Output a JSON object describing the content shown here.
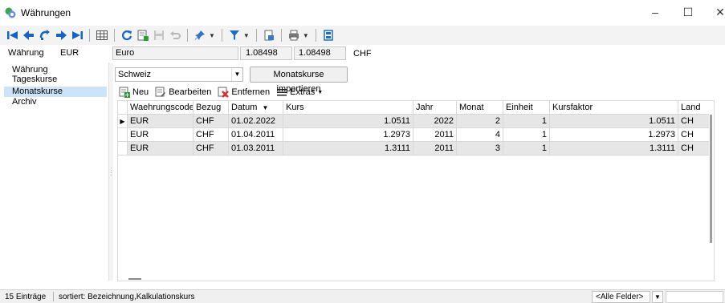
{
  "window": {
    "title": "Währungen",
    "minimize": "–",
    "maximize": "☐",
    "close": "✕"
  },
  "header": {
    "currency_label": "Währung",
    "currency_code": "EUR",
    "currency_name": "Euro",
    "rate1": "1.08498",
    "rate2": "1.08498",
    "base_currency": "CHF"
  },
  "nav": {
    "items": [
      {
        "label": "Währung"
      },
      {
        "label": "Tageskurse"
      },
      {
        "label": "Monatskurse"
      },
      {
        "label": "Archiv"
      }
    ],
    "selected_index": 2
  },
  "controls": {
    "country": "Schweiz",
    "import_button": "Monatskurse importieren"
  },
  "subtoolbar": {
    "new": "Neu",
    "edit": "Bearbeiten",
    "remove": "Entfernen",
    "extras": "Extras"
  },
  "grid": {
    "columns": [
      "Waehrungscode",
      "Bezug",
      "Datum",
      "Kurs",
      "Jahr",
      "Monat",
      "Einheit",
      "Kursfaktor",
      "Land"
    ],
    "sort_indicator": "▼",
    "rows": [
      [
        "EUR",
        "CHF",
        "01.02.2022",
        "1.0511",
        "2022",
        "2",
        "1",
        "1.0511",
        "CH"
      ],
      [
        "EUR",
        "CHF",
        "01.04.2011",
        "1.2973",
        "2011",
        "4",
        "1",
        "1.2973",
        "CH"
      ],
      [
        "EUR",
        "CHF",
        "01.03.2011",
        "1.3111",
        "2011",
        "3",
        "1",
        "1.3111",
        "CH"
      ]
    ],
    "current_row_marker": "▶"
  },
  "status": {
    "count": "15 Einträge",
    "sort": "sortiert: Bezeichnung,Kalkulationskurs",
    "filter": "<Alle Felder>"
  },
  "colors": {
    "accent": "#0a64c8",
    "selection": "#cce4f7",
    "row_alt": "#e6e6e6"
  }
}
